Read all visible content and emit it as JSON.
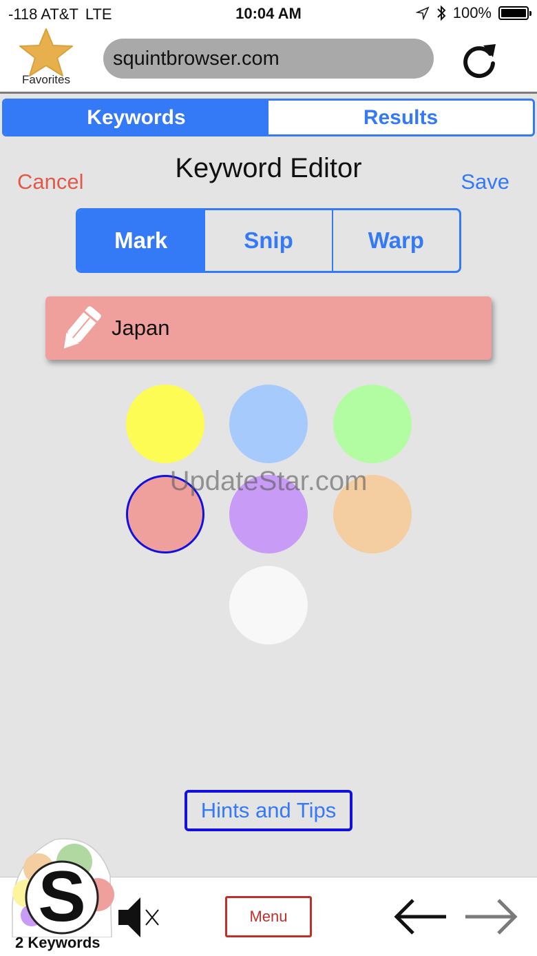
{
  "status": {
    "carrier": "-118 AT&T",
    "network": "LTE",
    "time": "10:04 AM",
    "battery": "100%",
    "battery_level": 1.0,
    "icons": [
      "location-icon",
      "bluetooth-icon",
      "battery-icon"
    ]
  },
  "browser": {
    "favorites_label": "Favorites",
    "url": "squintbrowser.com"
  },
  "tabs": {
    "keywords": "Keywords",
    "results": "Results",
    "selected": "Keywords"
  },
  "editor": {
    "cancel": "Cancel",
    "title": "Keyword Editor",
    "save": "Save",
    "modes": [
      "Mark",
      "Snip",
      "Warp"
    ],
    "selected_mode": "Mark",
    "keyword": "Japan",
    "keyword_color": "#f0a09c",
    "swatches": [
      "#fdfc54",
      "#a6cafc",
      "#b2fca2",
      "#f0a09c",
      "#c89cf6",
      "#f4cda0",
      "#f8f8f8"
    ],
    "selected_swatch": "#f0a09c"
  },
  "watermark": "UpdateStar.com",
  "hints_button": "Hints and Tips",
  "bottom": {
    "keyword_count": "2 Keywords",
    "menu": "Menu"
  },
  "colors": {
    "accent": "#3479f6",
    "cancel": "#e05a4a",
    "menu": "#c0302a"
  }
}
